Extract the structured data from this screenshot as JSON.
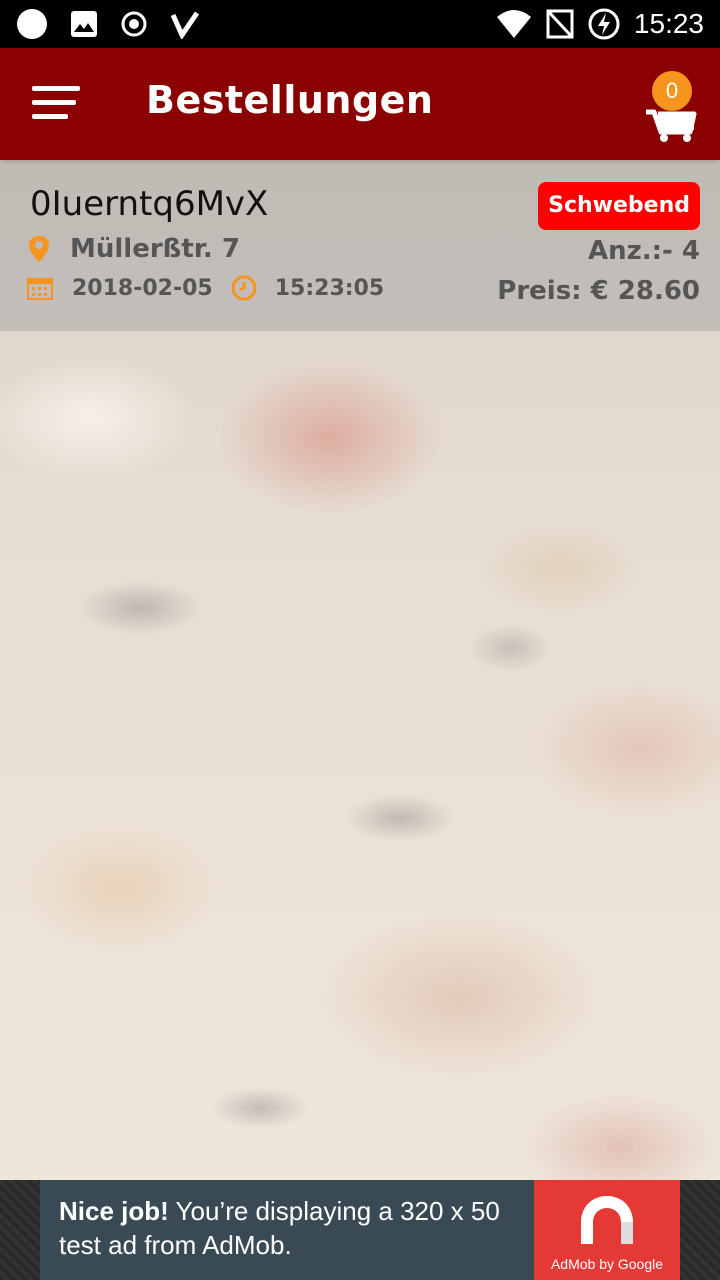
{
  "status_bar": {
    "time": "15:23",
    "left_icons": [
      "circle-icon",
      "image-icon",
      "record-icon",
      "check-icon"
    ],
    "right_icons": [
      "wifi-icon",
      "no-signal-icon",
      "battery-charging-icon"
    ]
  },
  "app_bar": {
    "title": "Bestellungen",
    "cart_count": "0"
  },
  "orders": [
    {
      "id": "0Iuerntq6MvX",
      "status": "Schwebend",
      "address": "Müllerßtr. 7",
      "date": "2018-02-05",
      "time": "15:23:05",
      "quantity": "Anz.:- 4",
      "price": "Preis: € 28.60"
    }
  ],
  "ad": {
    "bold": "Nice job!",
    "text": " You’re displaying a 320 x 50 test ad from AdMob.",
    "logo_caption": "AdMob by Google"
  },
  "colors": {
    "app_bar": "#8b0000",
    "status_badge": "#ff0000",
    "cart_badge": "#f7941d",
    "icon_accent": "#f7941d"
  }
}
